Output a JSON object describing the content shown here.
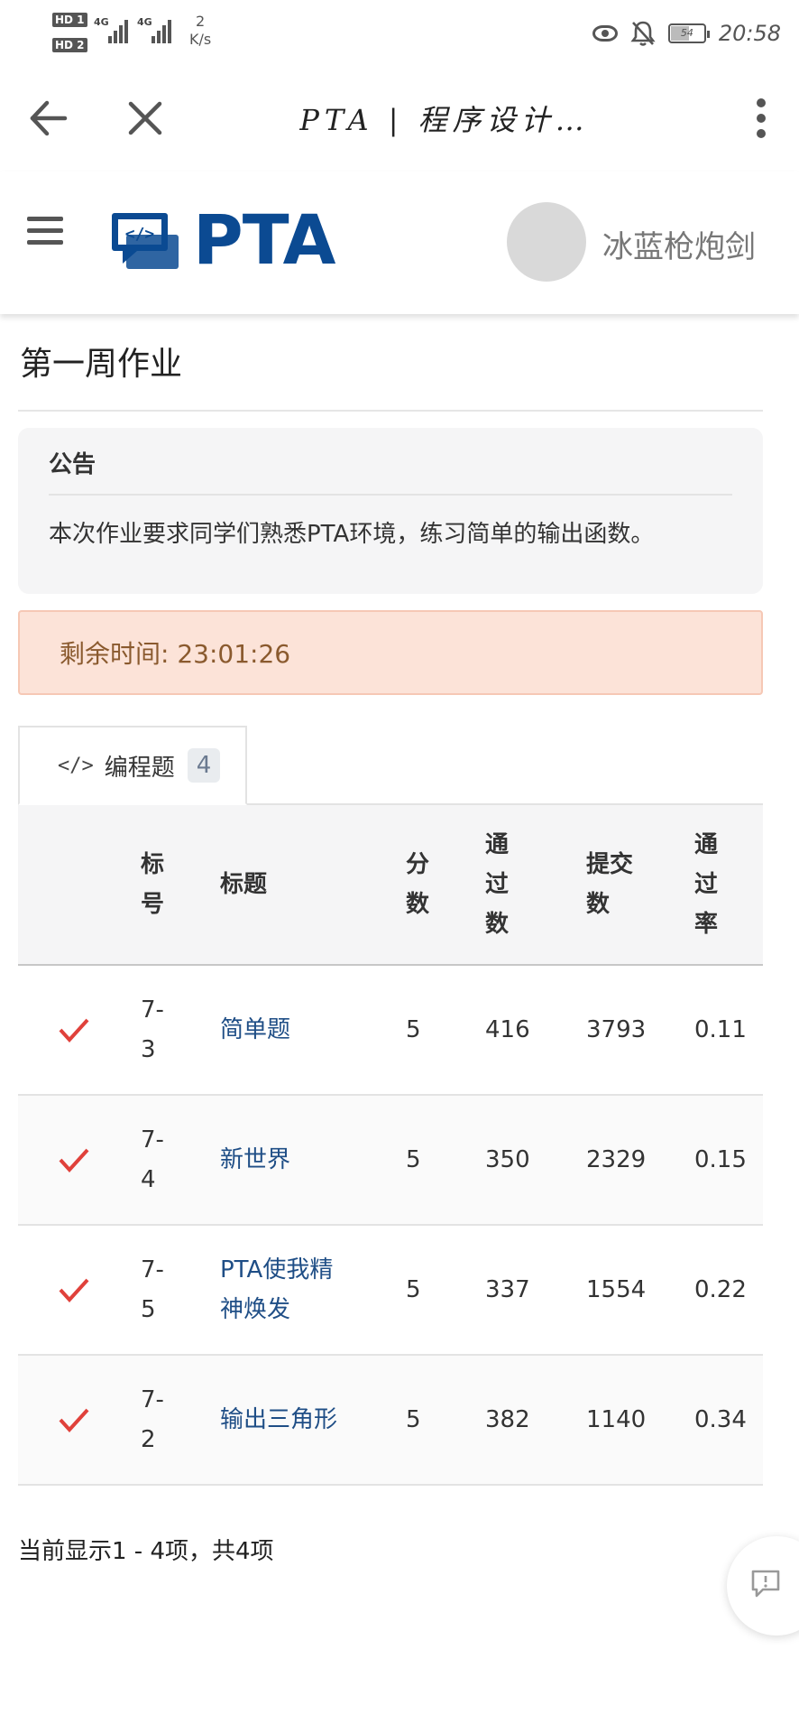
{
  "status_bar": {
    "hd1": "HD 1",
    "hd2": "HD 2",
    "net1": "4G",
    "net2": "4G",
    "speed_value": "2",
    "speed_unit": "K/s",
    "battery": "54",
    "time": "20:58"
  },
  "browser": {
    "title": "PTA | 程序设计…"
  },
  "header": {
    "logo_text": "PTA",
    "username": "冰蓝枪炮剑"
  },
  "page": {
    "title": "第一周作业",
    "notice": {
      "title": "公告",
      "body": "本次作业要求同学们熟悉PTA环境，练习简单的输出函数。"
    },
    "timer": "剩余时间: 23:01:26",
    "tab": {
      "label": "编程题",
      "count": "4"
    },
    "table": {
      "headers": [
        "",
        "标号",
        "标题",
        "分数",
        "通过数",
        "提交数",
        "通过率"
      ],
      "rows": [
        {
          "status": "passed",
          "id": "7-3",
          "title": "简单题",
          "score": "5",
          "passed": "416",
          "submitted": "3793",
          "rate": "0.11"
        },
        {
          "status": "passed",
          "id": "7-4",
          "title": "新世界",
          "score": "5",
          "passed": "350",
          "submitted": "2329",
          "rate": "0.15"
        },
        {
          "status": "passed",
          "id": "7-5",
          "title": "PTA使我精神焕发",
          "score": "5",
          "passed": "337",
          "submitted": "1554",
          "rate": "0.22"
        },
        {
          "status": "passed",
          "id": "7-2",
          "title": "输出三角形",
          "score": "5",
          "passed": "382",
          "submitted": "1140",
          "rate": "0.34"
        }
      ]
    },
    "footer": "当前显示1 - 4项，共4项"
  },
  "colors": {
    "brand": "#0b4a92",
    "check": "#e0413b",
    "link": "#1f4e86",
    "timer_bg": "#fce3d8"
  }
}
